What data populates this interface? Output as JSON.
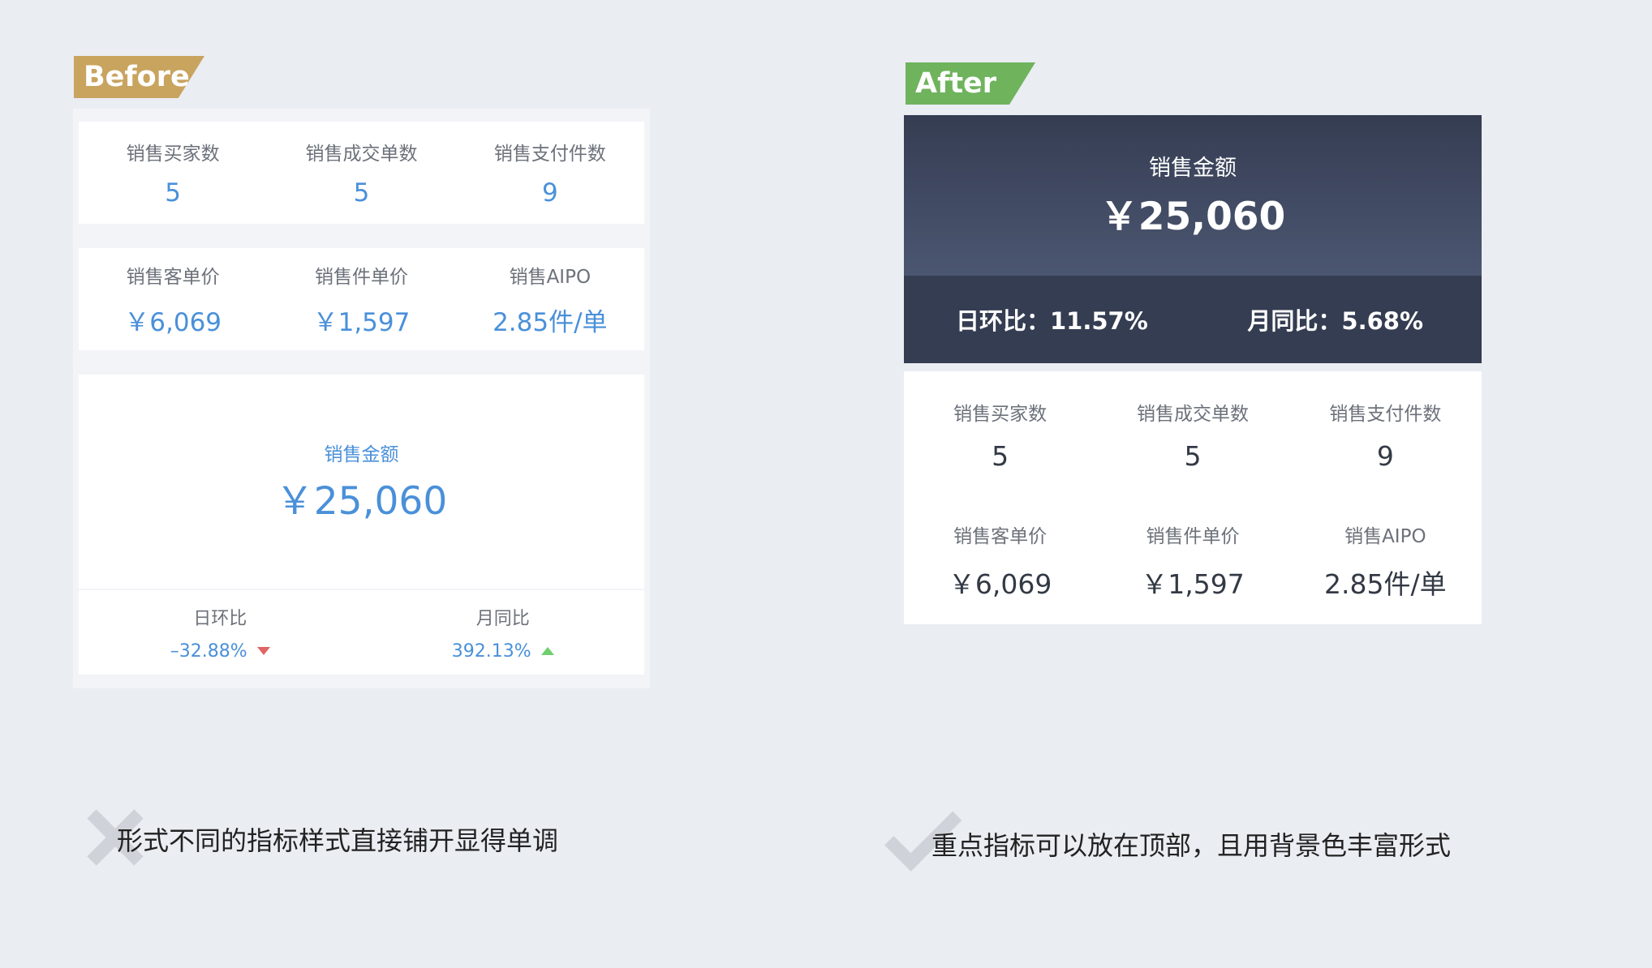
{
  "before": {
    "tag": "Before",
    "row1": [
      {
        "label": "销售买家数",
        "value": "5"
      },
      {
        "label": "销售成交单数",
        "value": "5"
      },
      {
        "label": "销售支付件数",
        "value": "9"
      }
    ],
    "row2": [
      {
        "label": "销售客单价",
        "value": "￥6,069"
      },
      {
        "label": "销售件单价",
        "value": "￥1,597"
      },
      {
        "label": "销售AIPO",
        "value": "2.85件/单"
      }
    ],
    "main": {
      "label": "销售金额",
      "value": "￥25,060"
    },
    "footer": [
      {
        "label": "日环比",
        "value": "–32.88%",
        "trend": "down"
      },
      {
        "label": "月同比",
        "value": "392.13%",
        "trend": "up"
      }
    ],
    "caption": "形式不同的指标样式直接铺开显得单调",
    "caption_icon": "cross-icon"
  },
  "after": {
    "tag": "After",
    "main": {
      "label": "销售金额",
      "value": "￥25,060"
    },
    "bar": [
      {
        "text": "日环比：11.57%"
      },
      {
        "text": "月同比：5.68%"
      }
    ],
    "row1": [
      {
        "label": "销售买家数",
        "value": "5"
      },
      {
        "label": "销售成交单数",
        "value": "5"
      },
      {
        "label": "销售支付件数",
        "value": "9"
      }
    ],
    "row2": [
      {
        "label": "销售客单价",
        "value": "￥6,069"
      },
      {
        "label": "销售件单价",
        "value": "￥1,597"
      },
      {
        "label": "销售AIPO",
        "value": "2.85件/单"
      }
    ],
    "caption": "重点指标可以放在顶部，且用背景色丰富形式",
    "caption_icon": "check-icon"
  },
  "colors": {
    "background": "#eaedf2",
    "before_tag": "#c8a45f",
    "after_tag": "#6fb35d",
    "accent_blue": "#4a90d9",
    "dark_header": "#353d52",
    "trend_down": "#e06565",
    "trend_up": "#6fcf6f"
  }
}
